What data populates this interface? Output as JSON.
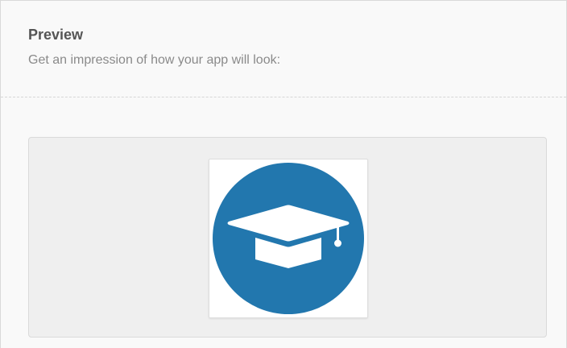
{
  "preview": {
    "title": "Preview",
    "subtitle": "Get an impression of how your app will look:"
  },
  "app_icon": {
    "icon_name": "graduation-cap-icon",
    "background_color": "#2277ae",
    "foreground_color": "#ffffff"
  }
}
